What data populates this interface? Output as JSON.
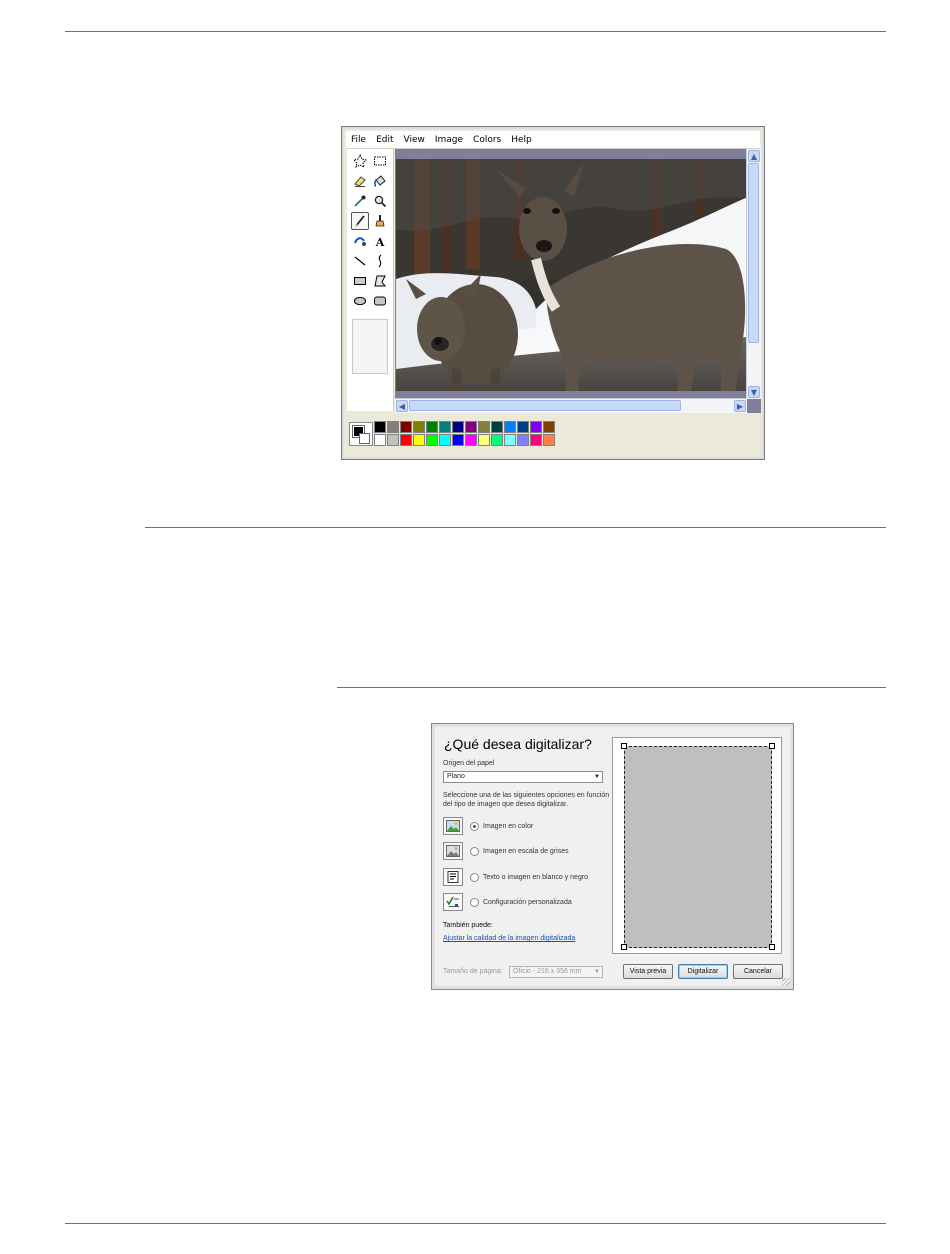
{
  "paint_window": {
    "menu": [
      "File",
      "Edit",
      "View",
      "Image",
      "Colors",
      "Help"
    ],
    "tools": [
      "free-form-select",
      "rect-select",
      "eraser",
      "fill",
      "color-picker",
      "magnifier",
      "pencil",
      "brush",
      "airbrush",
      "text",
      "line",
      "curve",
      "rectangle",
      "polygon",
      "ellipse",
      "rounded-rectangle"
    ],
    "selected_tool": "pencil",
    "canvas_image": "two mule deer in snow",
    "colors": {
      "foreground": "#000000",
      "background": "#ffffff",
      "palette_top": [
        "#000000",
        "#808080",
        "#800000",
        "#808000",
        "#008000",
        "#008080",
        "#000080",
        "#800080",
        "#808040",
        "#004040",
        "#0080ff",
        "#004080",
        "#8000ff",
        "#804000"
      ],
      "palette_bottom": [
        "#ffffff",
        "#c0c0c0",
        "#ff0000",
        "#ffff00",
        "#00ff00",
        "#00ffff",
        "#0000ff",
        "#ff00ff",
        "#ffff80",
        "#00ff80",
        "#80ffff",
        "#8080ff",
        "#ff0080",
        "#ff8040"
      ]
    }
  },
  "scan_dialog": {
    "title": "¿Qué desea digitalizar?",
    "paper_source_label": "Origen del papel",
    "paper_source_value": "Plano",
    "instructions": "Seleccione una de las siguientes opciones en función del tipo de imagen que desea digitalizar.",
    "options": [
      {
        "label": "Imagen en color",
        "icon": "color-photo-icon",
        "selected": true
      },
      {
        "label": "Imagen en escala de grises",
        "icon": "grayscale-photo-icon",
        "selected": false
      },
      {
        "label": "Texto o imagen en blanco y negro",
        "icon": "text-document-icon",
        "selected": false
      },
      {
        "label": "Configuración personalizada",
        "icon": "custom-settings-icon",
        "selected": false
      }
    ],
    "also_label": "También puede:",
    "adjust_link": "Ajustar la calidad de la imagen digitalizada",
    "page_size_label": "Tamaño de página:",
    "page_size_value": "Oficio - 216 x 356 mm",
    "buttons": {
      "preview": "Vista previa",
      "scan": "Digitalizar",
      "cancel": "Cancelar"
    }
  }
}
